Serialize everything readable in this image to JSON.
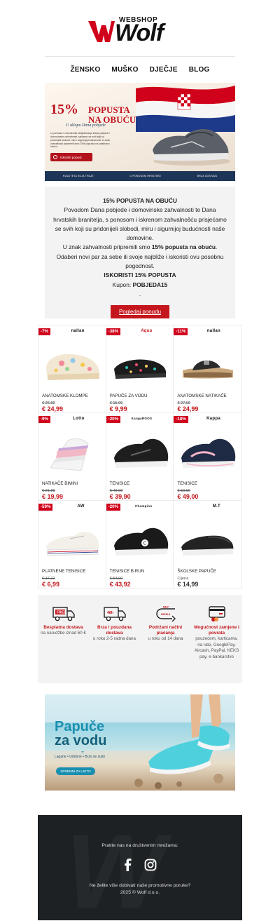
{
  "header": {
    "logo_webshop": "WEBSHOP",
    "logo_text": "Wolf"
  },
  "nav": {
    "items": [
      "ŽENSKO",
      "MUŠKO",
      "DJEČJE",
      "BLOG"
    ]
  },
  "hero": {
    "title_percent": "15%",
    "title_line1": "POPUSTA",
    "title_line2": "NA OBUĆU",
    "subtitle": "U sklopu Dana pobjede",
    "small_text": "U ponosan i zahvalnosti obilježavanju Dana pobjede i domovinske zahvalnosti, sjećamo se svih koji su pridonijeli slobodi, miru i sigurnijoj budućnosti. U znak zahvalnosti pripremili smo 15% popusta na odabranu obuću.",
    "button": "Iskoristi popust",
    "strip": [
      "KVALITETA KOJA TRAJE",
      "O PONOSOM HRVATSKE",
      "BRZA DOSTAVA"
    ]
  },
  "promo": {
    "heading": "15% POPUSTA NA OBUĆU",
    "body1": "Povodom Dana pobjede i domovinske zahvalnosti te Dana hrvatskih branitelja, s ponosom i iskrenom zahvalnošću prisjećamo se svih koji su pridonijeli slobodi, miru i sigurnijoj budućnosti naše domovine.",
    "body2_pre": "U znak zahvalnosti pripremili smo ",
    "body2_bold": "15% popusta na obuću",
    "body2_post": ".",
    "body3": "Odaberi novi par za sebe ili svoje najbliže i iskoristi ovu posebnu pogodnost.",
    "cta_text": "ISKORISTI 15% POPUSTA",
    "coupon_label": "Kupon: ",
    "coupon_code": "POBJEDA15",
    "dot": ".",
    "button": "Pogledaj ponudu"
  },
  "products": [
    {
      "badge": "-7%",
      "brand": "nallan",
      "name": "ANATOMSKE KLOMPE",
      "old": "€ 26,90",
      "price": "€ 24,99"
    },
    {
      "badge": "-38%",
      "brand": "Aqua",
      "name": "PAPUČE ZA VODU",
      "old": "€ 15,99",
      "price": "€ 9,99"
    },
    {
      "badge": "-11%",
      "brand": "nallan",
      "name": "ANATOMSKE NATIKAČE",
      "old": "€ 27,99",
      "price": "€ 24,99"
    },
    {
      "badge": "-9%",
      "brand": "Lotto",
      "name": "NATIKAČE BIMINI",
      "old": "€ 21,99",
      "price": "€ 19,99"
    },
    {
      "badge": "-20%",
      "brand": "KangaROOS",
      "name": "TENISICE",
      "old": "€ 49,99",
      "price": "€ 39,90"
    },
    {
      "badge": "-18%",
      "brand": "Kappa",
      "name": "TENISICE",
      "old": "€ 59,99",
      "price": "€ 49,00"
    },
    {
      "badge": "-59%",
      "brand": "AW",
      "name": "PLATNENE TENISICE",
      "old": "€ 17,12",
      "price": "€ 6,99"
    },
    {
      "badge": "-20%",
      "brand": "Champion",
      "name": "TENISICE B RUN",
      "old": "€ 54,90",
      "price": "€ 43,92"
    },
    {
      "badge": "",
      "brand": "M.T",
      "name": "ŠKOLSKE PAPUČE",
      "label": "Cijena",
      "price": "€ 14,99"
    }
  ],
  "benefits": [
    {
      "icon_tag": "FREE",
      "title": "Besplatna dostava",
      "text": "na narudžbe iznad 60 €"
    },
    {
      "icon_tag": "48h",
      "title": "Brza i pouzdana dostava",
      "text": "u roku 2-5 radna dana"
    },
    {
      "icon_tag": "BEZ RIZIKA",
      "title": "Podržani načini plaćanja",
      "text": "u roku od 14 dana"
    },
    {
      "icon_tag": "",
      "title": "Mogućnost zamjene i povrata",
      "text": "pouzećem, karticama, na rate, GooglePay, Aircash, PayPal, KEKS pay, e-bankarstvo"
    }
  ],
  "water_banner": {
    "title_line1": "Papuče",
    "title_line2": "za vodu",
    "subtitle": "Lagane • Udobne • Brzo se suše",
    "button": "SPREMNI ZA LJETO"
  },
  "footer": {
    "follow": "Pratite nas na društvenim mrežama:",
    "optout": "Ne želite više dobivati naše promotivne poruke?",
    "copyright": "2025 © Wolf d.o.o."
  },
  "colors": {
    "accent_red": "#c4161c",
    "footer_bg": "#1e2124",
    "benefits_bg": "#f3f3f3"
  }
}
